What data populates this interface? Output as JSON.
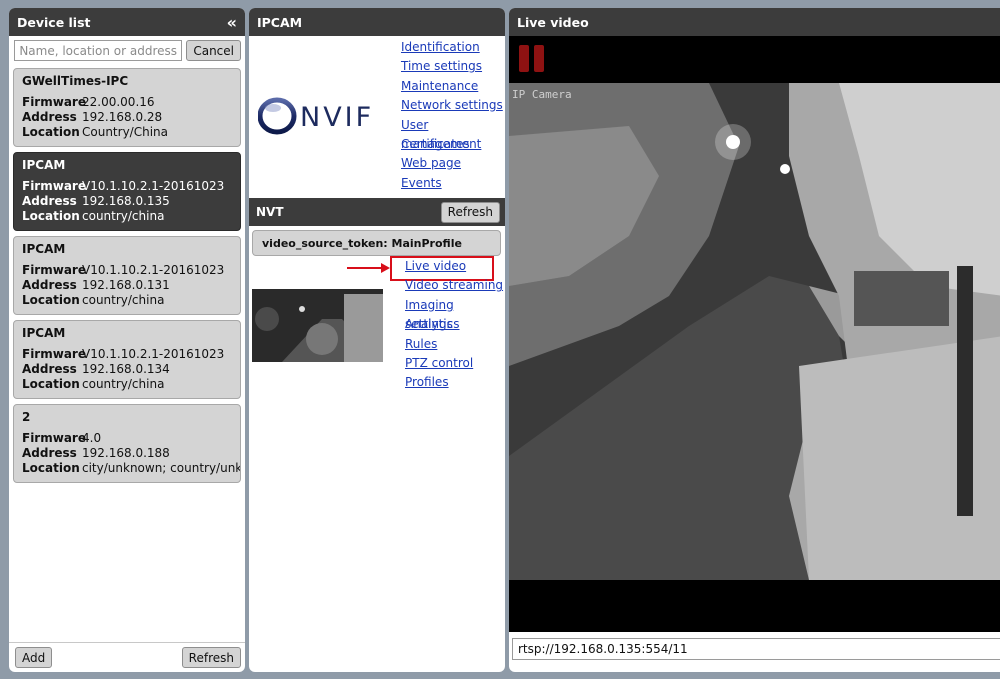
{
  "device_list": {
    "title": "Device list",
    "collapse_icon": "double-chevron-left-icon",
    "search_placeholder": "Name, location or address",
    "cancel_label": "Cancel",
    "devices": [
      {
        "name": "GWellTimes-IPC",
        "firmware": "22.00.00.16",
        "address": "192.168.0.28",
        "location": "Country/China"
      },
      {
        "name": "IPCAM",
        "firmware": "V10.1.10.2.1-20161023",
        "address": "192.168.0.135",
        "location": "country/china"
      },
      {
        "name": "IPCAM",
        "firmware": "V10.1.10.2.1-20161023",
        "address": "192.168.0.131",
        "location": "country/china"
      },
      {
        "name": "IPCAM",
        "firmware": "V10.1.10.2.1-20161023",
        "address": "192.168.0.134",
        "location": "country/china"
      },
      {
        "name": "2",
        "firmware": "4.0",
        "address": "192.168.0.188",
        "location": "city/unknown; country/unkn"
      }
    ],
    "selected_index": 1,
    "field_labels": {
      "firmware": "Firmware",
      "address": "Address",
      "location": "Location"
    },
    "add_label": "Add",
    "refresh_label": "Refresh"
  },
  "ipcam": {
    "title": "IPCAM",
    "logo_text": "ONVIF",
    "menu": [
      "Identification",
      "Time settings",
      "Maintenance",
      "Network settings",
      "User management",
      "Certificates",
      "Web page",
      "Events"
    ]
  },
  "nvt": {
    "title": "NVT",
    "refresh_label": "Refresh",
    "profile_label": "video_source_token: MainProfile",
    "links": [
      "Live video",
      "Video streaming",
      "Imaging settings",
      "Analytics",
      "Rules",
      "PTZ control",
      "Profiles"
    ],
    "highlighted_link": "Live video"
  },
  "live_video": {
    "title": "Live video",
    "camera_overlay": "IP Camera",
    "stream_url": "rtsp://192.168.0.135:554/11",
    "pause_icon": "pause-icon"
  },
  "colors": {
    "header_bg": "#3c3c3c",
    "link": "#1a3ab8",
    "highlight": "#d80f1a",
    "pause": "#8e1212"
  }
}
